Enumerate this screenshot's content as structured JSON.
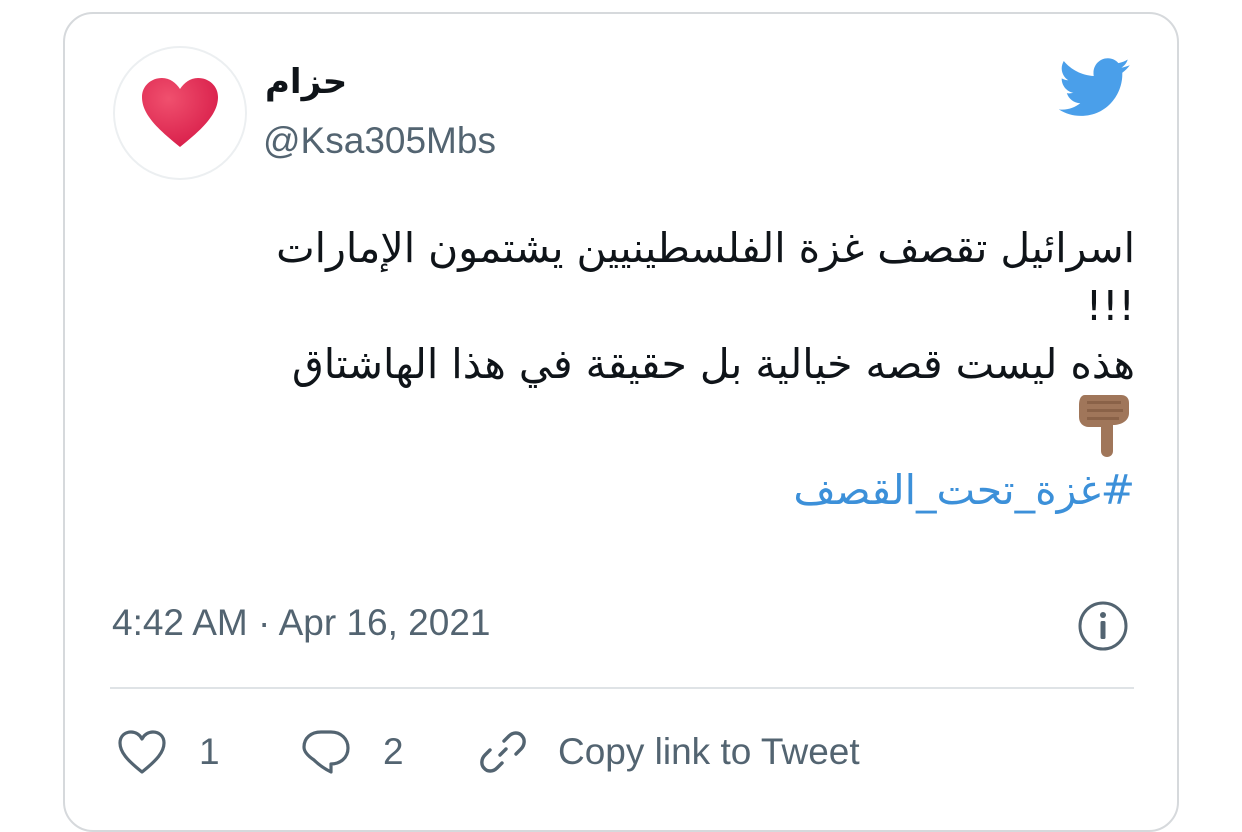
{
  "tweet": {
    "display_name": "حزام",
    "handle": "@Ksa305Mbs",
    "lines": [
      "اسرائيل تقصف غزة الفلسطينيين يشتمون الإمارات",
      "!!!",
      "هذه ليست قصه خيالية بل حقيقة في هذا  الهاشتاق"
    ],
    "emoji": "👇🏽",
    "hashtag": "#غزة_تحت_القصف",
    "timestamp": "4:42 AM · Apr 16, 2021"
  },
  "actions": {
    "like_count": "1",
    "reply_count": "2",
    "copy_link_label": "Copy link to Tweet"
  },
  "colors": {
    "twitter_blue": "#4a9fea",
    "hashtag": "#3c90d9",
    "heart": "#e0245e",
    "secondary_text": "#536471",
    "emoji_skin": "#a0765a"
  },
  "icons": {
    "avatar": "red-heart-icon",
    "brand": "twitter-bird-icon",
    "info": "info-icon",
    "like": "heart-outline-icon",
    "reply": "speech-bubble-icon",
    "copy": "link-icon"
  }
}
